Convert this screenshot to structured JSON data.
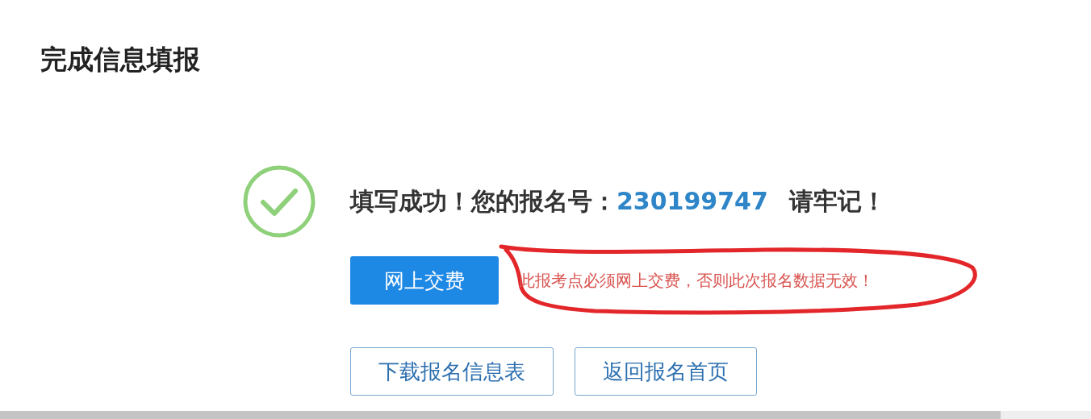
{
  "page": {
    "title": "完成信息填报"
  },
  "result": {
    "message": "填写成功！您的报名号：",
    "registration_number": "230199747",
    "reminder": "请牢记！"
  },
  "pay_button": "网上交费",
  "warning": "此报考点必须网上交费，否则此次报名数据无效！",
  "buttons": [
    "下载报名信息表",
    "返回报名首页"
  ]
}
